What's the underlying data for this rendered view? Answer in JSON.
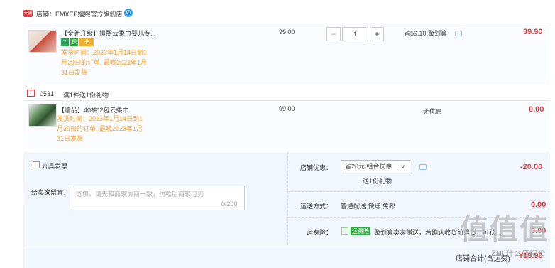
{
  "shop": {
    "badge": "天猫",
    "name": "店铺：EMXEE嫚熙官方旗舰店",
    "chat_icon": "wangwang-icon"
  },
  "items": [
    {
      "title": "【全新升级】嫚熙云柔巾婴儿专...",
      "tags": [
        "7",
        "保",
        "卡"
      ],
      "ship_note": [
        "发货时间：2023年1月14日到1",
        "月29日的订单, 最晚2023年1月",
        "31日发货"
      ],
      "unit_price": "99.00",
      "qty": "1",
      "promo": "省59.10:聚划算",
      "subtotal": "39.90"
    },
    {
      "title": "【赠品】40抽*2包云柔巾",
      "ship_note": [
        "发货时间：2023年1月14日到1",
        "月29日的订单, 最晚2023年1月",
        "31日发货"
      ],
      "unit_price": "99.00",
      "promo": "无优惠",
      "subtotal": "0.00"
    }
  ],
  "gift": {
    "code": "0531",
    "desc": "满1件送1份礼物"
  },
  "qty_controls": {
    "minus": "−",
    "plus": "+"
  },
  "invoice": {
    "label": "开具发票"
  },
  "message": {
    "label": "给卖家留言：",
    "placeholder": "选填，请先和商家协商一致，付款后商家可见",
    "counter": "0/200"
  },
  "shop_discount": {
    "label": "店铺优惠：",
    "selected": "省20元:组合优惠",
    "note": "送1份礼物",
    "value": "-20.00"
  },
  "shipping": {
    "label": "运送方式：",
    "value_text": "普通配送 快递 免邮",
    "amount": "0.00"
  },
  "insurance": {
    "label": "运费险：",
    "tag": "运费险",
    "text": "聚划算卖家赠送，若确认收货前退货，可获...",
    "amount": "0.00"
  },
  "total": {
    "label": "店铺合计(含运费)",
    "value": "¥19.90"
  },
  "watermark": {
    "main": "值值值",
    "sub": "ZHI 什么值得买"
  },
  "colors": {
    "accent_red": "#e4393c",
    "note_orange": "#f79e26",
    "panel_blue": "#f2f7ff",
    "link_blue": "#2d9ee8"
  }
}
